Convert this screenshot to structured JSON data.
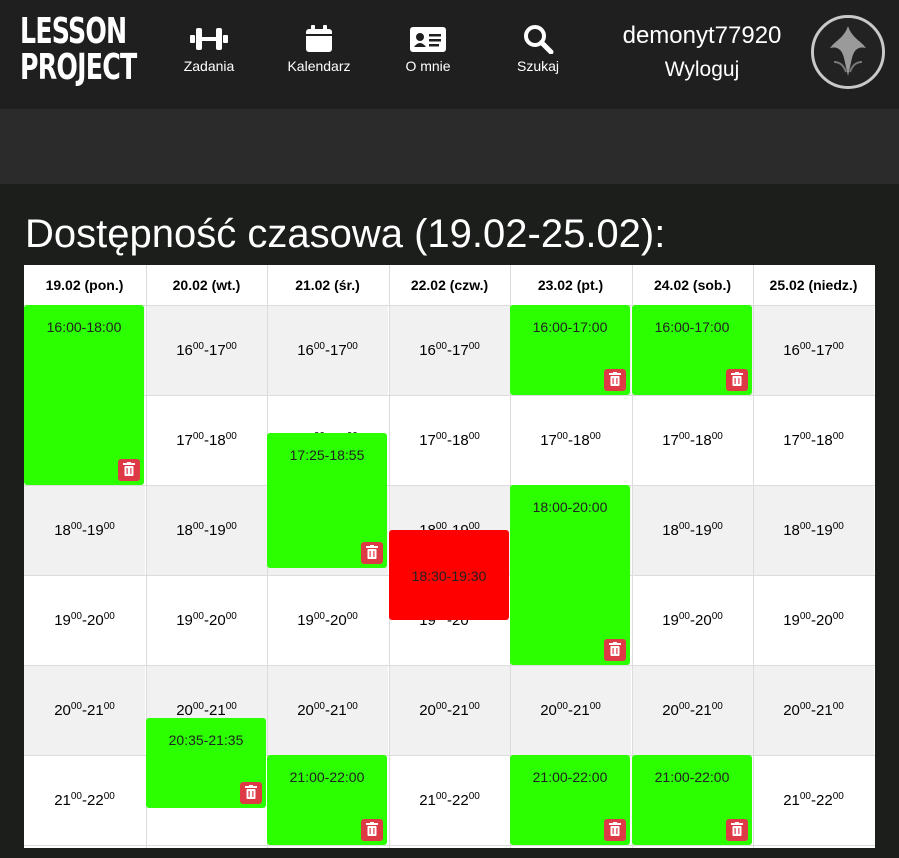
{
  "header": {
    "logo_line1": "LESSON",
    "logo_line2": "PROJECT",
    "nav": [
      {
        "label": "Zadania",
        "icon": "dumbbell-icon"
      },
      {
        "label": "Kalendarz",
        "icon": "calendar-icon"
      },
      {
        "label": "O mnie",
        "icon": "id-card-icon"
      },
      {
        "label": "Szukaj",
        "icon": "search-icon"
      }
    ],
    "username": "demonyt77920",
    "logout": "Wyloguj"
  },
  "page": {
    "title": "Dostępność czasowa (19.02-25.02):"
  },
  "colors": {
    "available": "#2bff00",
    "booked": "#fe0000",
    "delete": "#de3a46"
  },
  "calendar": {
    "days": [
      "19.02 (pon.)",
      "20.02 (wt.)",
      "21.02 (śr.)",
      "22.02 (czw.)",
      "23.02 (pt.)",
      "24.02 (sob.)",
      "25.02 (niedz.)"
    ],
    "slots": [
      {
        "start": "16",
        "end": "17"
      },
      {
        "start": "17",
        "end": "18"
      },
      {
        "start": "18",
        "end": "19"
      },
      {
        "start": "19",
        "end": "20"
      },
      {
        "start": "20",
        "end": "21"
      },
      {
        "start": "21",
        "end": "22"
      }
    ],
    "slot_minutes": "00",
    "blocks": [
      {
        "day": 0,
        "label": "16:00-18:00",
        "status": "available",
        "deletable": true
      },
      {
        "day": 1,
        "label": "20:35-21:35",
        "status": "available",
        "deletable": true
      },
      {
        "day": 2,
        "label": "17:25-18:55",
        "status": "available",
        "deletable": true
      },
      {
        "day": 2,
        "label": "21:00-22:00",
        "status": "available",
        "deletable": true
      },
      {
        "day": 3,
        "label": "18:30-19:30",
        "status": "booked",
        "deletable": false
      },
      {
        "day": 4,
        "label": "16:00-17:00",
        "status": "available",
        "deletable": true
      },
      {
        "day": 4,
        "label": "18:00-20:00",
        "status": "available",
        "deletable": true
      },
      {
        "day": 4,
        "label": "21:00-22:00",
        "status": "available",
        "deletable": true
      },
      {
        "day": 5,
        "label": "16:00-17:00",
        "status": "available",
        "deletable": true
      },
      {
        "day": 5,
        "label": "21:00-22:00",
        "status": "available",
        "deletable": true
      }
    ]
  }
}
